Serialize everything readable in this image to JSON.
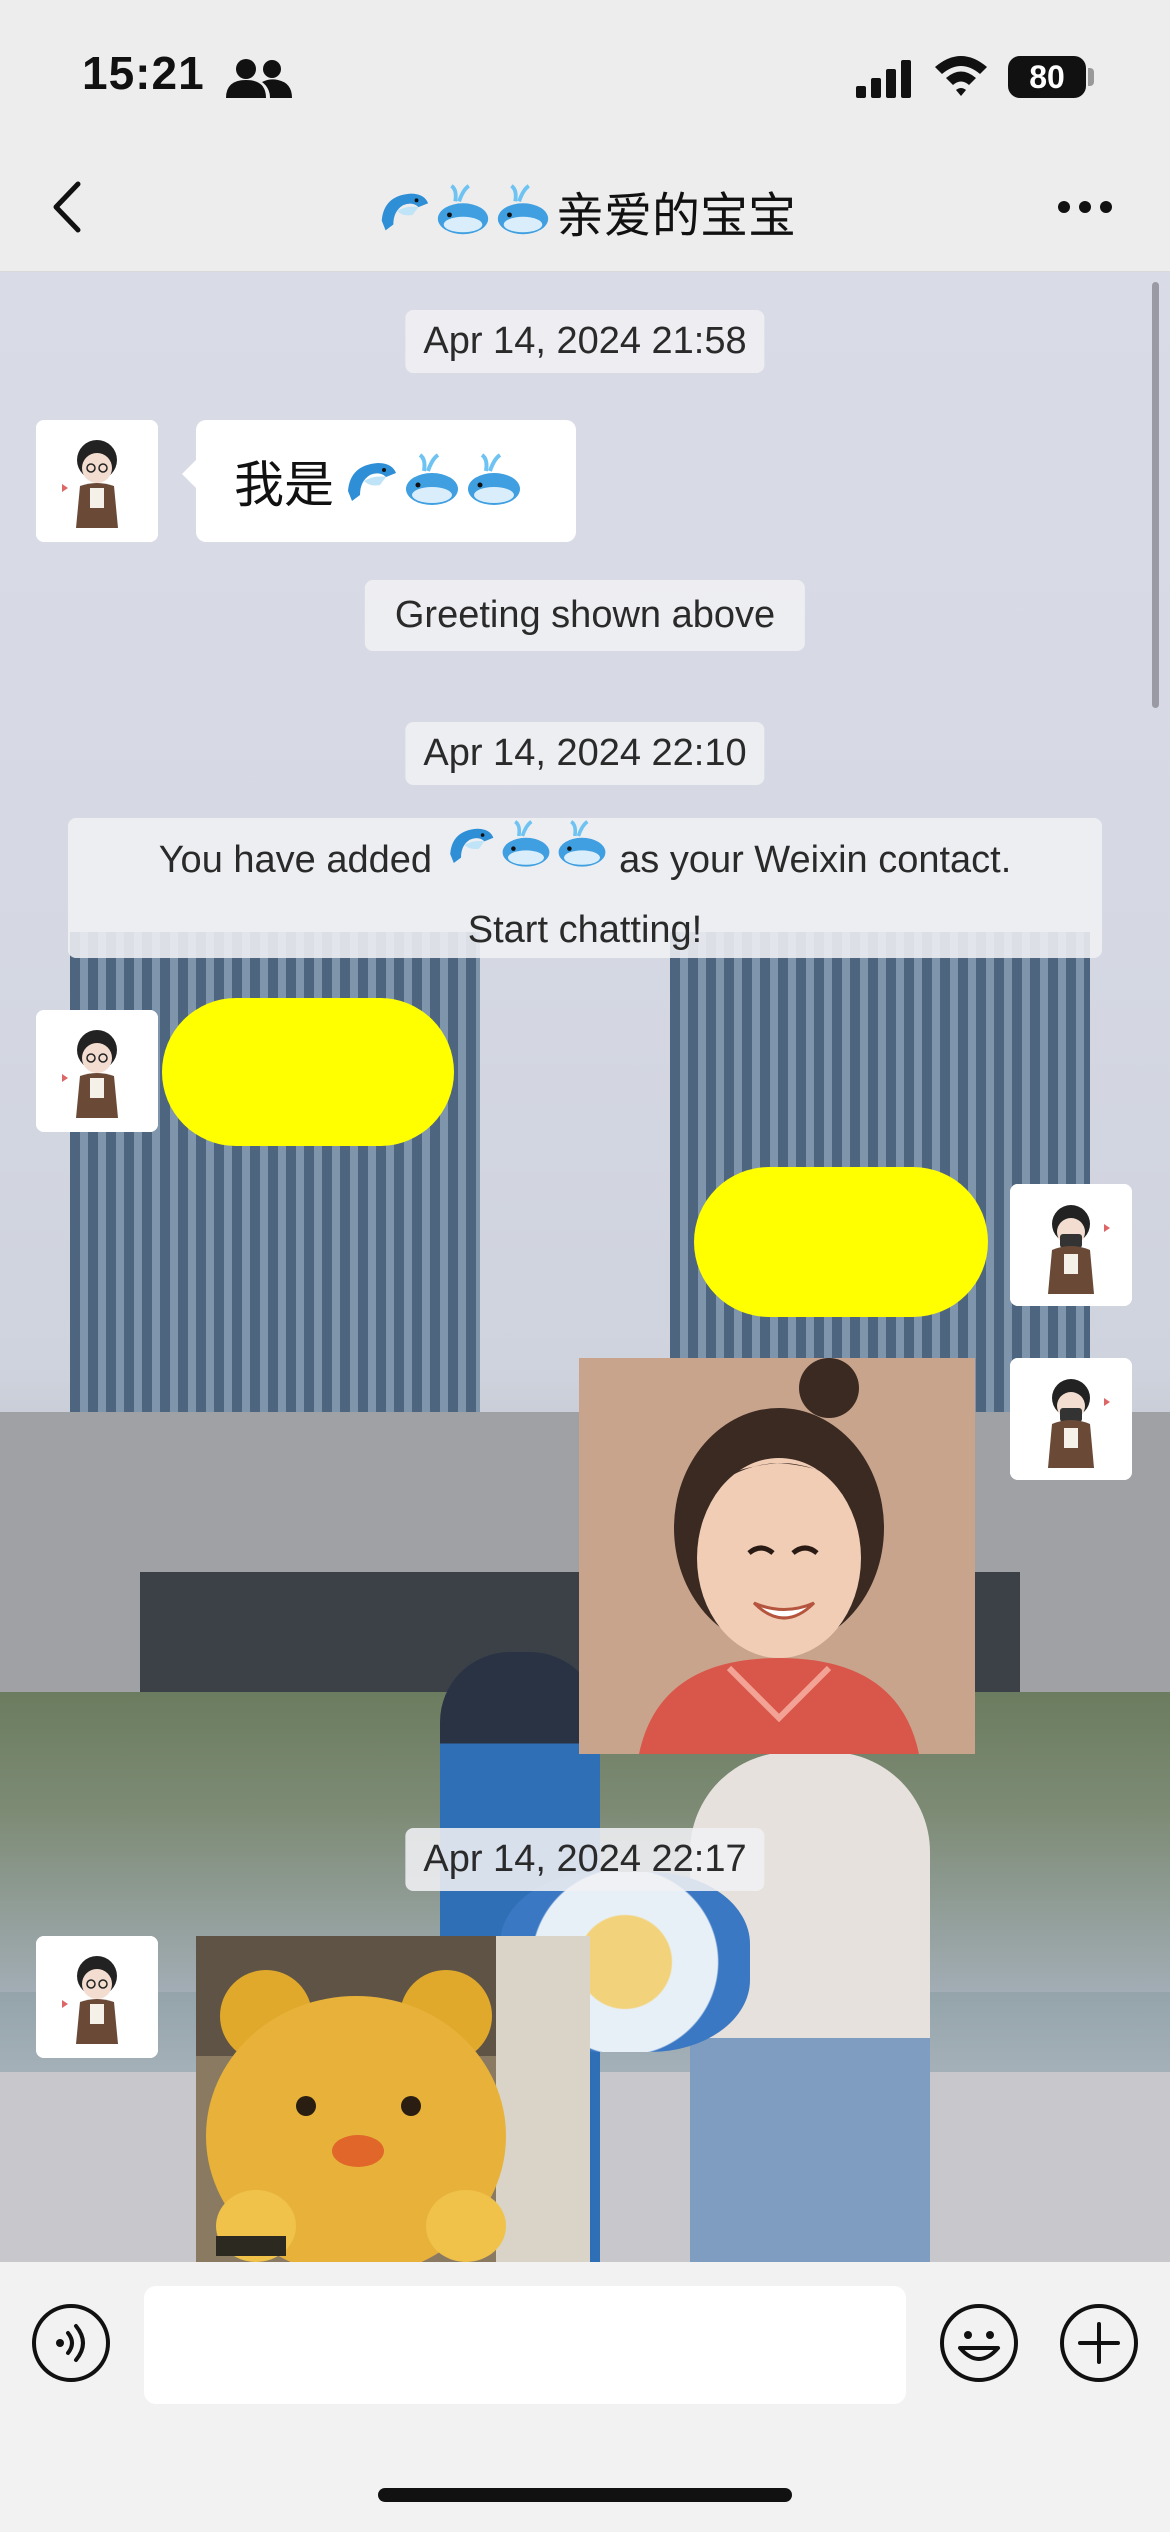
{
  "status_bar": {
    "time": "15:21",
    "battery": "80"
  },
  "header": {
    "title_suffix": "亲爱的宝宝",
    "emoji_names": [
      "dolphin",
      "whale",
      "whale"
    ]
  },
  "messages": {
    "ts1": "Apr 14, 2024 21:58",
    "greeting_text": "我是",
    "greeting_note": "Greeting shown above",
    "ts2": "Apr 14, 2024 22:10",
    "added_prefix": "You have added",
    "added_suffix": "as your Weixin contact.",
    "added_line2": "Start chatting!",
    "ts3": "Apr 14, 2024 22:17"
  },
  "colors": {
    "redaction": "#ffff00",
    "bubble_incoming": "#ffffff",
    "timestamp_bg": "#f0f0f4"
  },
  "icons": [
    "back-icon",
    "more-icon",
    "people-icon",
    "signal-icon",
    "wifi-icon",
    "voice-icon",
    "emoji-icon",
    "plus-icon"
  ]
}
